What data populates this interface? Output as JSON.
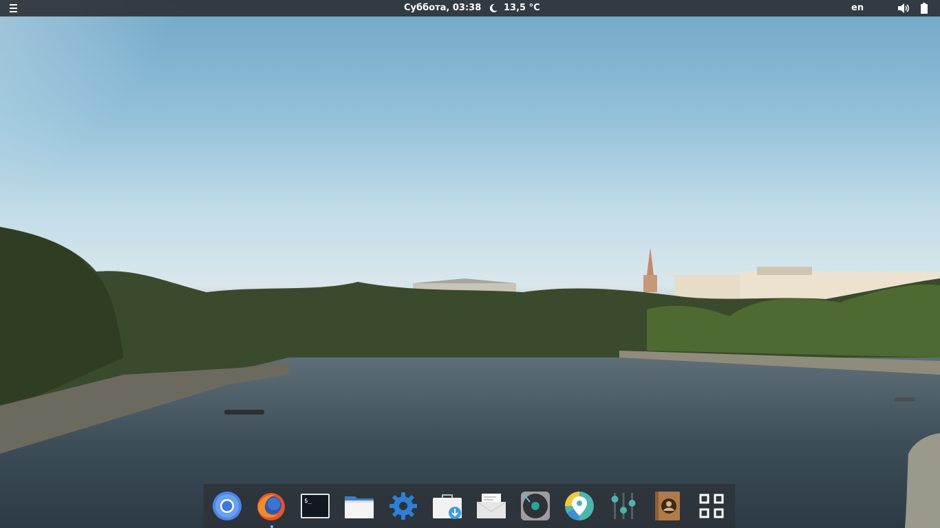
{
  "top_panel": {
    "menu_icon": "hamburger-menu-icon",
    "clock": "Суббота, 03:38",
    "weather_icon": "moon-icon",
    "temperature": "13,5 °C",
    "keyboard_layout": "en",
    "volume_icon": "speaker-volume-icon",
    "battery_icon": "battery-icon"
  },
  "wallpaper": {
    "description_icon": "river-cityscape-photo"
  },
  "dock": {
    "items": [
      {
        "name": "chromium",
        "icon": "chromium-icon",
        "running": false
      },
      {
        "name": "firefox",
        "icon": "firefox-icon",
        "running": true
      },
      {
        "name": "terminal",
        "icon": "terminal-icon",
        "prompt": "$_",
        "running": false
      },
      {
        "name": "files",
        "icon": "folder-icon",
        "running": false
      },
      {
        "name": "settings",
        "icon": "gear-icon",
        "running": false
      },
      {
        "name": "software-store",
        "icon": "store-download-icon",
        "running": false
      },
      {
        "name": "mail",
        "icon": "mail-icon",
        "running": false
      },
      {
        "name": "music",
        "icon": "music-player-icon",
        "running": false
      },
      {
        "name": "maps",
        "icon": "map-pin-icon",
        "running": false
      },
      {
        "name": "equalizer",
        "icon": "sliders-icon",
        "running": false
      },
      {
        "name": "contacts",
        "icon": "contacts-book-icon",
        "running": false
      },
      {
        "name": "app-grid",
        "icon": "app-grid-icon",
        "running": false
      }
    ]
  },
  "colors": {
    "panel_bg": "#282c30",
    "dock_bg": "#2d3238",
    "running_indicator": "#6fb6ff"
  }
}
